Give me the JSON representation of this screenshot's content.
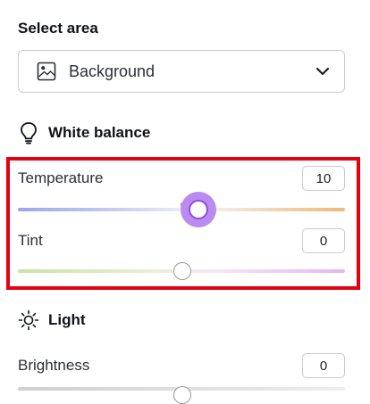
{
  "select_area": {
    "title": "Select area",
    "selected": "Background",
    "icon": "image-icon",
    "chevron": "chevron-down-icon"
  },
  "white_balance": {
    "title": "White balance",
    "icon": "lightbulb-icon",
    "highlight_color": "#e4000f",
    "temperature": {
      "label": "Temperature",
      "value": "10",
      "accent": "#8d4fe0"
    },
    "tint": {
      "label": "Tint",
      "value": "0"
    }
  },
  "light": {
    "title": "Light",
    "icon": "sun-icon",
    "brightness": {
      "label": "Brightness",
      "value": "0"
    }
  }
}
